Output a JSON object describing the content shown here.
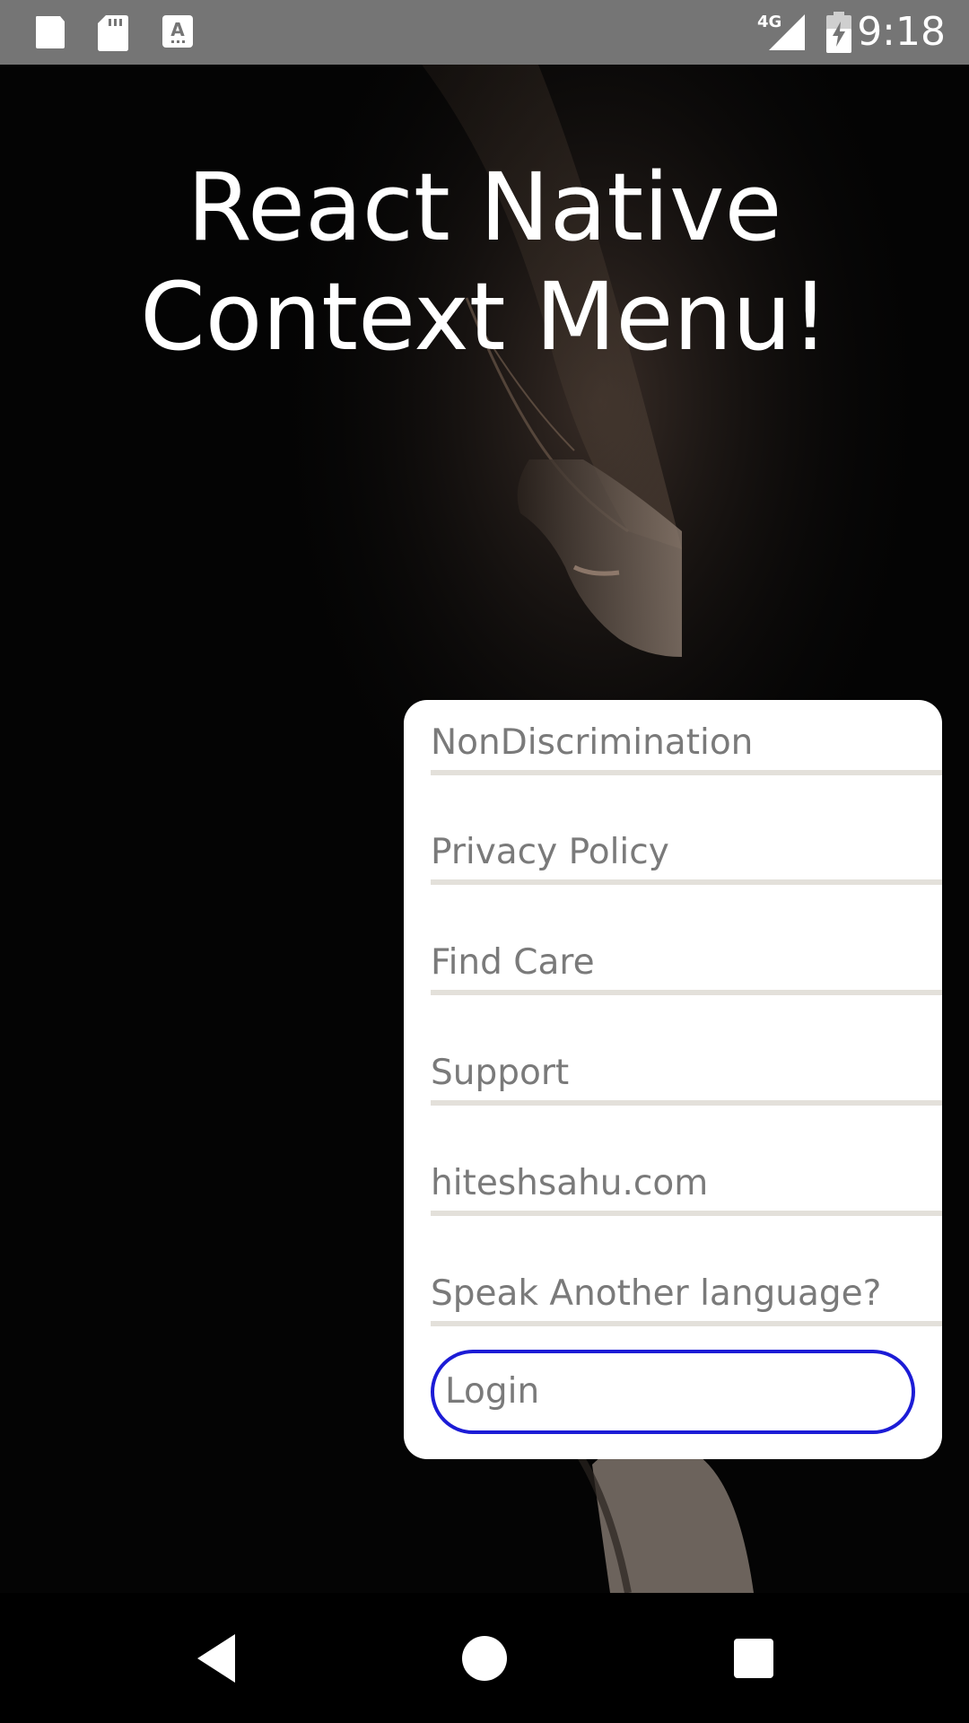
{
  "status_bar": {
    "time": "9:18",
    "network": "4G",
    "left_icons": [
      "notification-square-icon",
      "sd-card-icon",
      "keyboard-a-icon"
    ],
    "right_icons": [
      "signal-4g-icon",
      "battery-charging-icon"
    ]
  },
  "title": {
    "line1": "React Native",
    "line2": "Context Menu!"
  },
  "menu": {
    "items": [
      {
        "label": "NonDiscrimination"
      },
      {
        "label": "Privacy Policy"
      },
      {
        "label": "Find Care"
      },
      {
        "label": "Support"
      },
      {
        "label": "hiteshsahu.com"
      },
      {
        "label": "Speak Another language?"
      }
    ],
    "login_label": "Login",
    "login_border_color": "#1c1cd6",
    "text_color": "#7a7a7a",
    "divider_color": "#e3e0da"
  },
  "nav_bar": {
    "buttons": [
      "back-icon",
      "home-icon",
      "recents-icon"
    ]
  }
}
